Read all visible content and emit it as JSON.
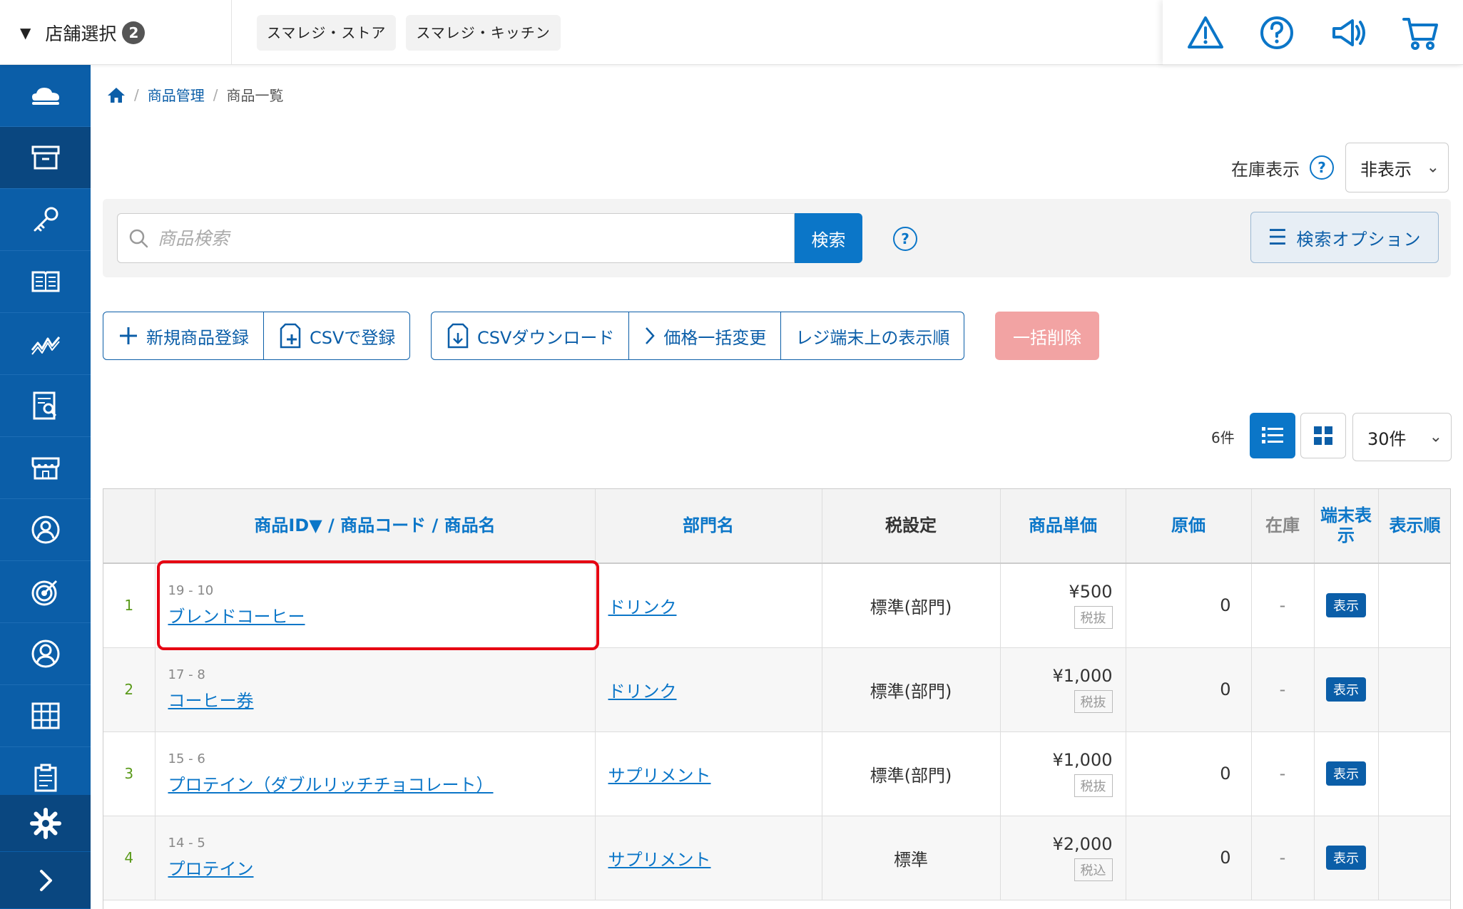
{
  "topbar": {
    "store_select_label": "店舗選択",
    "store_count": "2",
    "store_tabs": [
      "スマレジ・ストア",
      "スマレジ・キッチン"
    ]
  },
  "breadcrumb": {
    "items": [
      "商品管理",
      "商品一覧"
    ]
  },
  "stock_display": {
    "label": "在庫表示",
    "help": "?",
    "value": "非表示"
  },
  "search": {
    "placeholder": "商品検索",
    "button_label": "検索",
    "help": "?",
    "options_label": "検索オプション"
  },
  "actions": {
    "new_product": "新規商品登録",
    "csv_register": "CSVで登録",
    "csv_download": "CSVダウンロード",
    "bulk_price": "価格一括変更",
    "register_order": "レジ端末上の表示順",
    "bulk_delete": "一括削除"
  },
  "list_controls": {
    "count": "6件",
    "page_size": "30件"
  },
  "table": {
    "headers": {
      "product": "商品ID▼ / 商品コード / 商品名",
      "department": "部門名",
      "tax": "税設定",
      "price": "商品単価",
      "cost": "原価",
      "stock": "在庫",
      "terminal": "端末表示",
      "order": "表示順"
    },
    "rows": [
      {
        "no": "1",
        "ids": "19 - 10",
        "name": "ブレンドコーヒー",
        "dept": "ドリンク",
        "tax": "標準(部門)",
        "price": "¥500",
        "tax_type": "税抜",
        "cost": "0",
        "stock": "-",
        "terminal": "表示"
      },
      {
        "no": "2",
        "ids": "17 - 8",
        "name": "コーヒー券",
        "dept": "ドリンク",
        "tax": "標準(部門)",
        "price": "¥1,000",
        "tax_type": "税抜",
        "cost": "0",
        "stock": "-",
        "terminal": "表示"
      },
      {
        "no": "3",
        "ids": "15 - 6",
        "name": "プロテイン（ダブルリッチチョコレート）",
        "dept": "サプリメント",
        "tax": "標準(部門)",
        "price": "¥1,000",
        "tax_type": "税抜",
        "cost": "0",
        "stock": "-",
        "terminal": "表示"
      },
      {
        "no": "4",
        "ids": "14 - 5",
        "name": "プロテイン",
        "dept": "サプリメント",
        "tax": "標準",
        "price": "¥2,000",
        "tax_type": "税込",
        "cost": "0",
        "stock": "-",
        "terminal": "表示"
      }
    ]
  },
  "colors": {
    "brand_blue": "#0b5ea8",
    "accent_blue": "#0b76c8",
    "delete_pink": "#f2a3a3",
    "highlight_red": "#e60012"
  }
}
